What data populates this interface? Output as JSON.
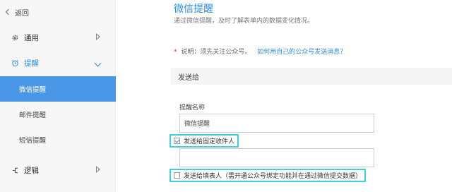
{
  "sidebar": {
    "back_label": "返回",
    "items": [
      {
        "label": "通用",
        "icon": "gear-icon"
      },
      {
        "label": "提醒",
        "icon": "alarm-icon"
      },
      {
        "label": "逻辑",
        "icon": "logic-icon"
      }
    ],
    "sub_items": [
      {
        "label": "微信提醒",
        "active": true
      },
      {
        "label": "邮件提醒",
        "active": false
      },
      {
        "label": "短信提醒",
        "active": false
      }
    ]
  },
  "main": {
    "title": "微信提醒",
    "description": "通过微信提醒，及时了解表单内的数据变化情况。",
    "note_text": "说明：须先关注公众号。",
    "note_link": "如何用自己的公众号发送消息？",
    "section_title": "发送给",
    "name_label": "提醒名称",
    "name_value": "微信提醒",
    "option_fixed": "发送给固定收件人",
    "option_filler": "发送给填表人（需开通公众号绑定功能并在通过微信提交数据）"
  },
  "colors": {
    "accent": "#2f8ddd",
    "active_bg": "#4a97e8",
    "highlight": "#3fd0d6"
  }
}
